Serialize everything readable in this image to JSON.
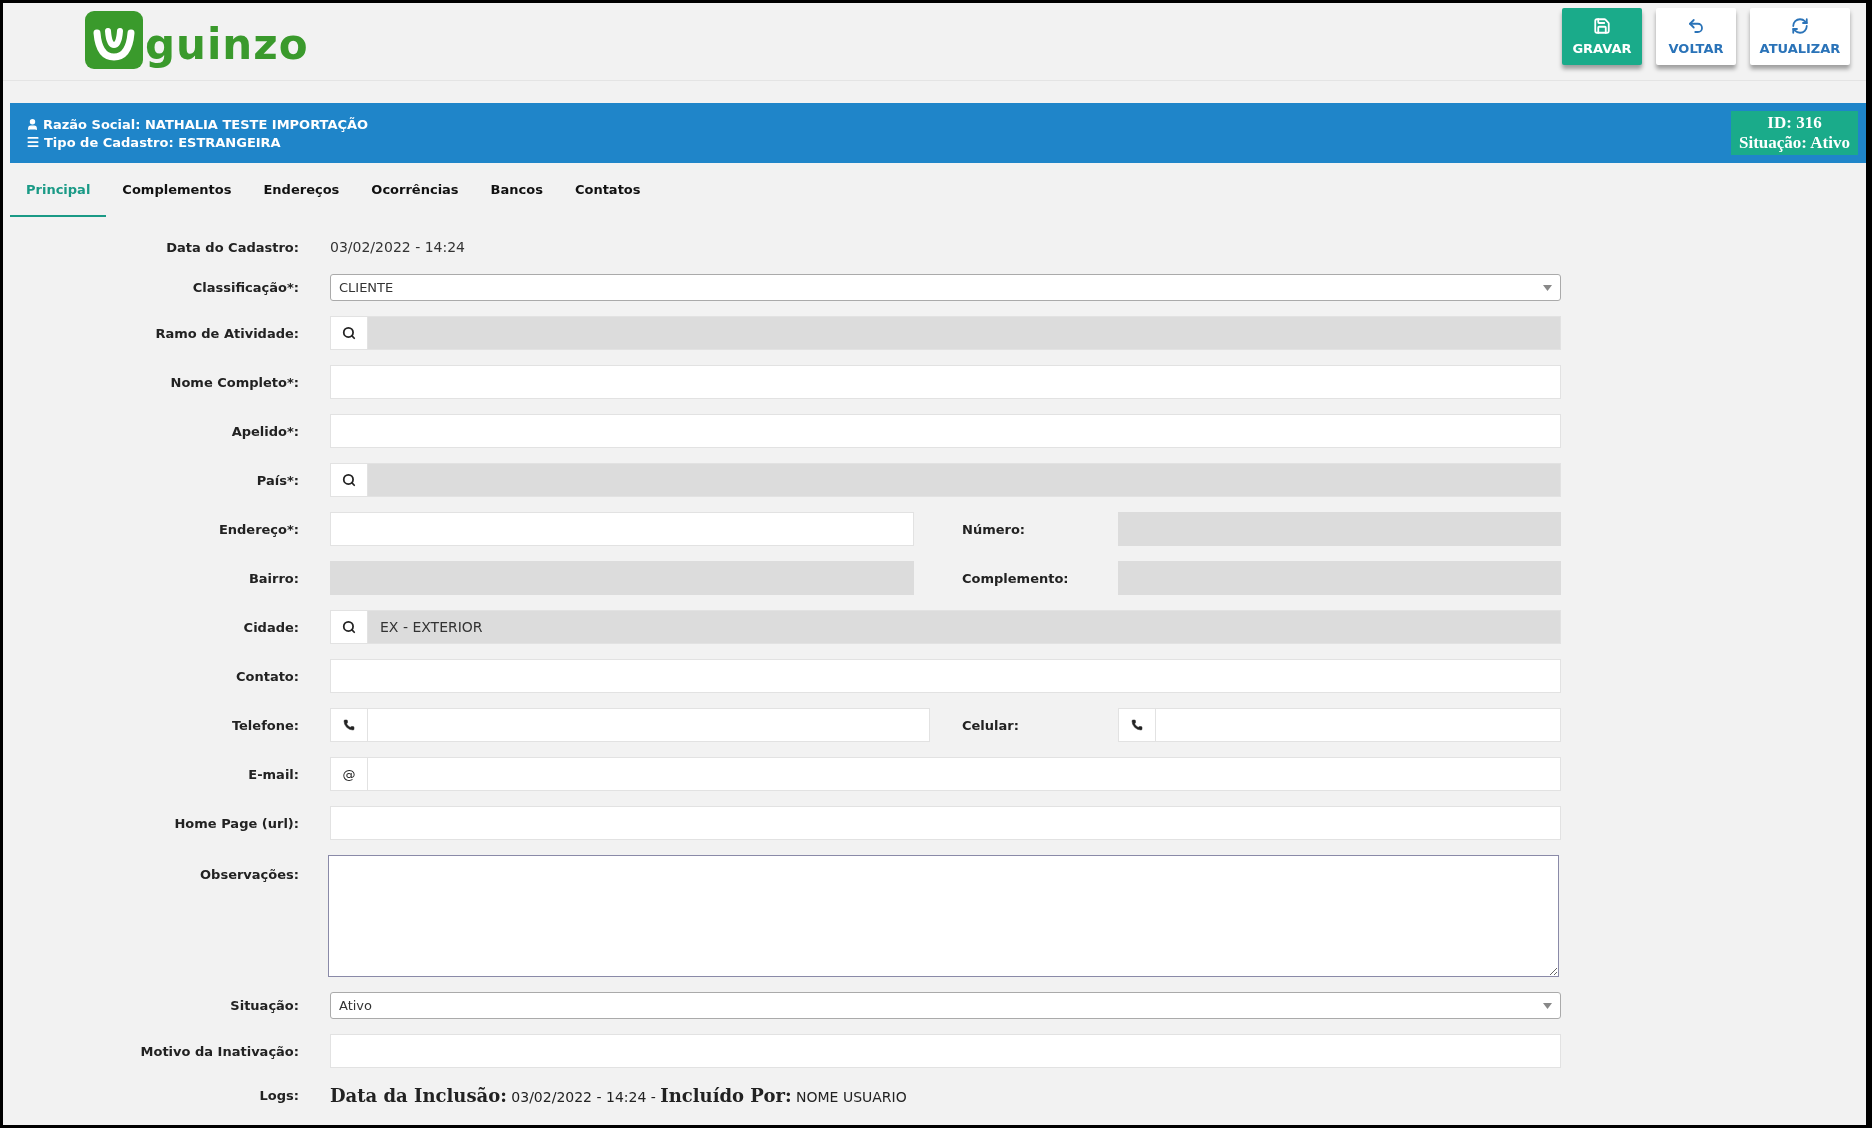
{
  "header": {
    "logo_text": "guinzo",
    "buttons": [
      {
        "label": "GRAVAR",
        "kind": "save"
      },
      {
        "label": "VOLTAR",
        "kind": "back"
      },
      {
        "label": "ATUALIZAR",
        "kind": "refresh"
      }
    ]
  },
  "banner": {
    "lines": [
      {
        "kind": "company",
        "text": "Razão Social: NATHALIA TESTE IMPORTAÇÃO"
      },
      {
        "kind": "type",
        "text": "Tipo de Cadastro: ESTRANGEIRA"
      }
    ],
    "id": "ID: 316",
    "status": "Situação: Ativo"
  },
  "tabs": [
    {
      "label": "Principal",
      "selected": true
    },
    {
      "label": "Complementos",
      "selected": false
    },
    {
      "label": "Endereços",
      "selected": false
    },
    {
      "label": "Ocorrências",
      "selected": false
    },
    {
      "label": "Bancos",
      "selected": false
    },
    {
      "label": "Contatos",
      "selected": false
    }
  ],
  "form": [
    {
      "kind": "static",
      "label": "Data do Cadastro:",
      "value": "03/02/2022 - 14:24"
    },
    {
      "kind": "select",
      "label": "Classificação*:",
      "value": "CLIENTE"
    },
    {
      "kind": "lookup",
      "label": "Ramo de Atividade:"
    },
    {
      "kind": "text",
      "label": "Nome Completo*:"
    },
    {
      "kind": "text",
      "label": "Apelido*:"
    },
    {
      "kind": "lookup",
      "label": "País*:"
    },
    {
      "kind": "split",
      "label": "Endereço*:",
      "disabled": false,
      "right_label": "Número:",
      "right_disabled": true
    },
    {
      "kind": "split",
      "label": "Bairro:",
      "disabled": true,
      "right_label": "Complemento:",
      "right_disabled": true
    },
    {
      "kind": "lookup",
      "label": "Cidade:",
      "value": "EX - EXTERIOR"
    },
    {
      "kind": "text",
      "label": "Contato:"
    },
    {
      "kind": "phones",
      "label": "Telefone:",
      "right_label": "Celular:"
    },
    {
      "kind": "addon",
      "label": "E-mail:",
      "addon": "@"
    },
    {
      "kind": "text",
      "label": "Home Page (url):"
    },
    {
      "kind": "textarea",
      "label": "Observações:"
    },
    {
      "kind": "select",
      "label": "Situação:",
      "value": "Ativo"
    },
    {
      "kind": "text",
      "label": "Motivo da Inativação:"
    }
  ],
  "logs": {
    "label": "Logs:",
    "text": "**Data da Inclusão:** 03/02/2022 - 14:24 - **Incluído Por:** NOME USUARIO"
  }
}
